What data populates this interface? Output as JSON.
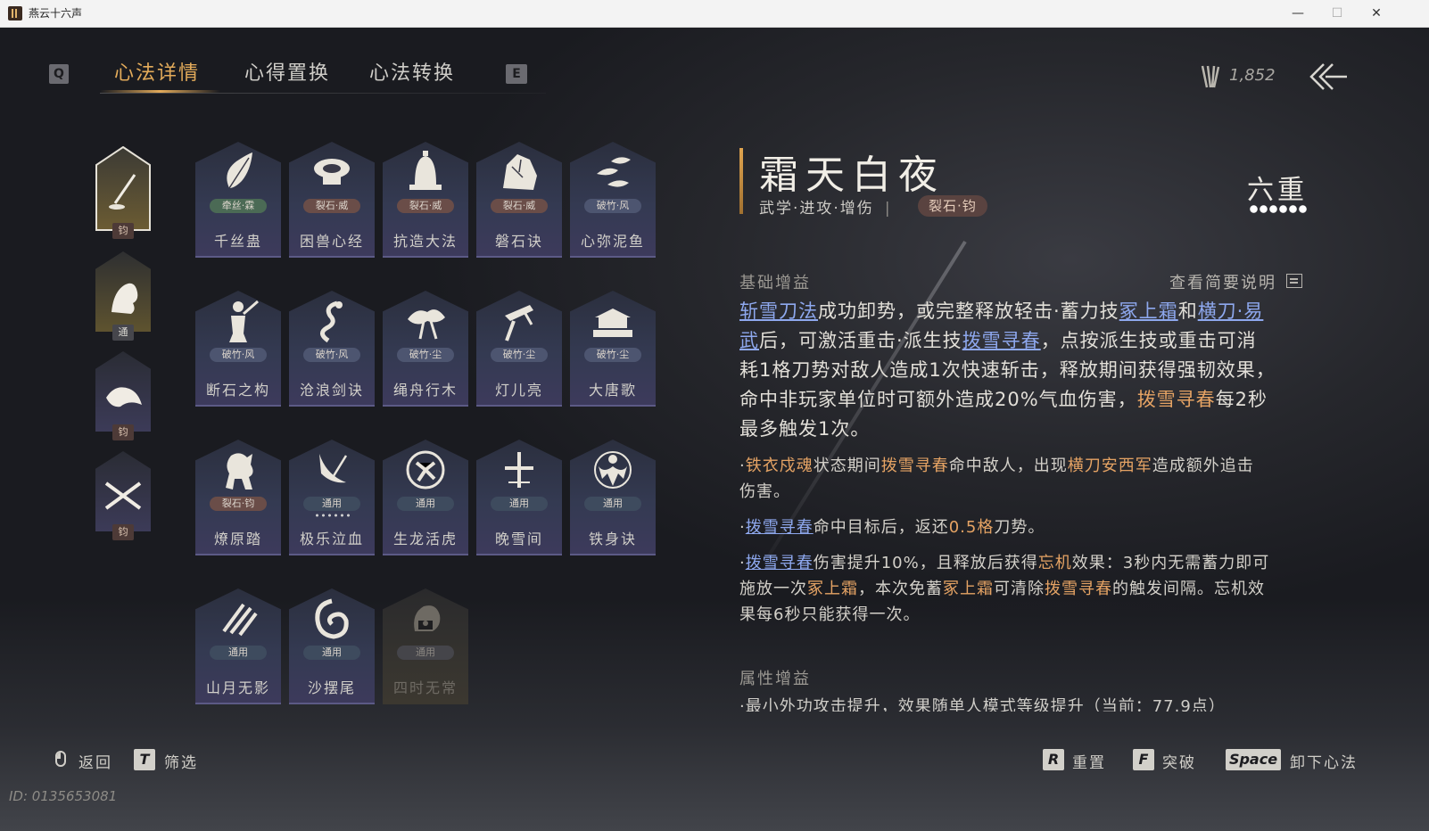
{
  "window": {
    "title": "燕云十六声",
    "minimize": "—",
    "maximize": "☐",
    "close": "✕"
  },
  "nav": {
    "left_key": "Q",
    "right_key": "E",
    "tabs": [
      {
        "label": "心法详情",
        "active": true
      },
      {
        "label": "心得置换",
        "active": false
      },
      {
        "label": "心法转换",
        "active": false
      }
    ],
    "currency_value": "1,852",
    "currency_icon": "feather-currency-icon",
    "back_icon": "double-arrow-back-icon"
  },
  "side_slots": [
    {
      "badge": "钧",
      "selected": true,
      "icon": "brush-stroke-icon"
    },
    {
      "badge": "通",
      "selected": false,
      "icon": "beast-icon"
    },
    {
      "badge": "钧",
      "selected": false,
      "icon": "bird-icon"
    },
    {
      "badge": "钧",
      "selected": false,
      "icon": "crossed-blades-icon"
    }
  ],
  "cards": [
    {
      "name": "千丝蛊",
      "tag": "牵丝·霖",
      "tag_color": 0,
      "icon": "leaf-icon"
    },
    {
      "name": "困兽心经",
      "tag": "裂石·威",
      "tag_color": 1,
      "icon": "collar-icon"
    },
    {
      "name": "抗造大法",
      "tag": "裂石·威",
      "tag_color": 1,
      "icon": "bell-icon"
    },
    {
      "name": "磐石诀",
      "tag": "裂石·威",
      "tag_color": 1,
      "icon": "rock-icon"
    },
    {
      "name": "心弥泥鱼",
      "tag": "破竹·风",
      "tag_color": 2,
      "icon": "fish-icon"
    },
    {
      "name": "断石之构",
      "tag": "破竹·风",
      "tag_color": 2,
      "icon": "warrior-icon"
    },
    {
      "name": "沧浪剑诀",
      "tag": "破竹·风",
      "tag_color": 2,
      "icon": "dragon-icon"
    },
    {
      "name": "绳舟行木",
      "tag": "破竹·尘",
      "tag_color": 2,
      "icon": "tree-icon"
    },
    {
      "name": "灯儿亮",
      "tag": "破竹·尘",
      "tag_color": 2,
      "icon": "lamp-icon"
    },
    {
      "name": "大唐歌",
      "tag": "破竹·尘",
      "tag_color": 2,
      "icon": "palace-icon"
    },
    {
      "name": "燎原踏",
      "tag": "裂石·钧",
      "tag_color": 1,
      "icon": "horse-icon"
    },
    {
      "name": "极乐泣血",
      "tag": "通用",
      "tag_color": 3,
      "icon": "crescent-blade-icon",
      "dots": true
    },
    {
      "name": "生龙活虎",
      "tag": "通用",
      "tag_color": 3,
      "icon": "spiral-icon"
    },
    {
      "name": "晚雪间",
      "tag": "通用",
      "tag_color": 3,
      "icon": "cross-icon"
    },
    {
      "name": "铁身诀",
      "tag": "通用",
      "tag_color": 3,
      "icon": "muscle-icon"
    },
    {
      "name": "山月无影",
      "tag": "通用",
      "tag_color": 3,
      "icon": "claw-icon"
    },
    {
      "name": "沙摆尾",
      "tag": "通用",
      "tag_color": 3,
      "icon": "swirl-icon"
    },
    {
      "name": "四时无常",
      "tag": "通用",
      "tag_color": 4,
      "icon": "ghost-icon",
      "dim": true
    }
  ],
  "detail": {
    "title": "霜天白夜",
    "types": "武学·进攻·增伤",
    "badge": "裂石·钧",
    "tier": "六重",
    "tier_level": 6,
    "section_basic": "基础增益",
    "help_link": "查看简要说明",
    "desc_1a": "斩雪刀法",
    "desc_1b": "成功卸势，或完整释放轻击·蓄力技",
    "desc_1c": "冢上霜",
    "desc_1d": "和",
    "desc_1e": "横刀·易",
    "desc_2a": "武",
    "desc_2b": "后，可激活重击·派生技",
    "desc_2c": "拨雪寻春",
    "desc_2d": "，点按派生技或重击可消",
    "desc_3": "耗1格刀势对敌人造成1次快速斩击，释放期间获得强韧效果，",
    "desc_4a": "命中非玩家单位时可额外造成20%气血伤害，",
    "desc_4b": "拨雪寻春",
    "desc_4c": "每2秒",
    "desc_5": "最多触发1次。",
    "sub1_a": "·",
    "sub1_b": "铁衣戍魂",
    "sub1_c": "状态期间",
    "sub1_d": "拨雪寻春",
    "sub1_e": "命中敌人，出现",
    "sub1_f": "横刀安西军",
    "sub1_g": "造成额外追击",
    "sub1_h": "伤害。",
    "sub2_a": "·",
    "sub2_b": "拨雪寻春",
    "sub2_c": "命中目标后，返还",
    "sub2_d": "0.5格",
    "sub2_e": "刀势。",
    "sub3_a": "·",
    "sub3_b": "拨雪寻春",
    "sub3_c": "伤害提升10%，且释放后获得",
    "sub3_d": "忘机",
    "sub3_e": "效果：3秒内无需蓄力即可",
    "sub3_f": "施放一次",
    "sub3_g": "冢上霜",
    "sub3_h": "，本次免蓄",
    "sub3_i": "冢上霜",
    "sub3_j": "可清除",
    "sub3_k": "拨雪寻春",
    "sub3_l": "的触发间隔。忘机效",
    "sub3_m": "果每6秒只能获得一次。",
    "section_attr": "属性增益",
    "attr_cut": "·最小外功攻击提升，效果随单人模式等级提升（当前：77.9点）"
  },
  "footer": {
    "back_label": "返回",
    "filter_key": "T",
    "filter_label": "筛选",
    "reset_key": "R",
    "reset_label": "重置",
    "break_key": "F",
    "break_label": "突破",
    "unequip_key": "Space",
    "unequip_label": "卸下心法"
  },
  "uid": "ID: 0135653081",
  "colors": {
    "accent": "#e3ab5a",
    "link": "#8ea8ee",
    "highlight": "#e5a364"
  }
}
